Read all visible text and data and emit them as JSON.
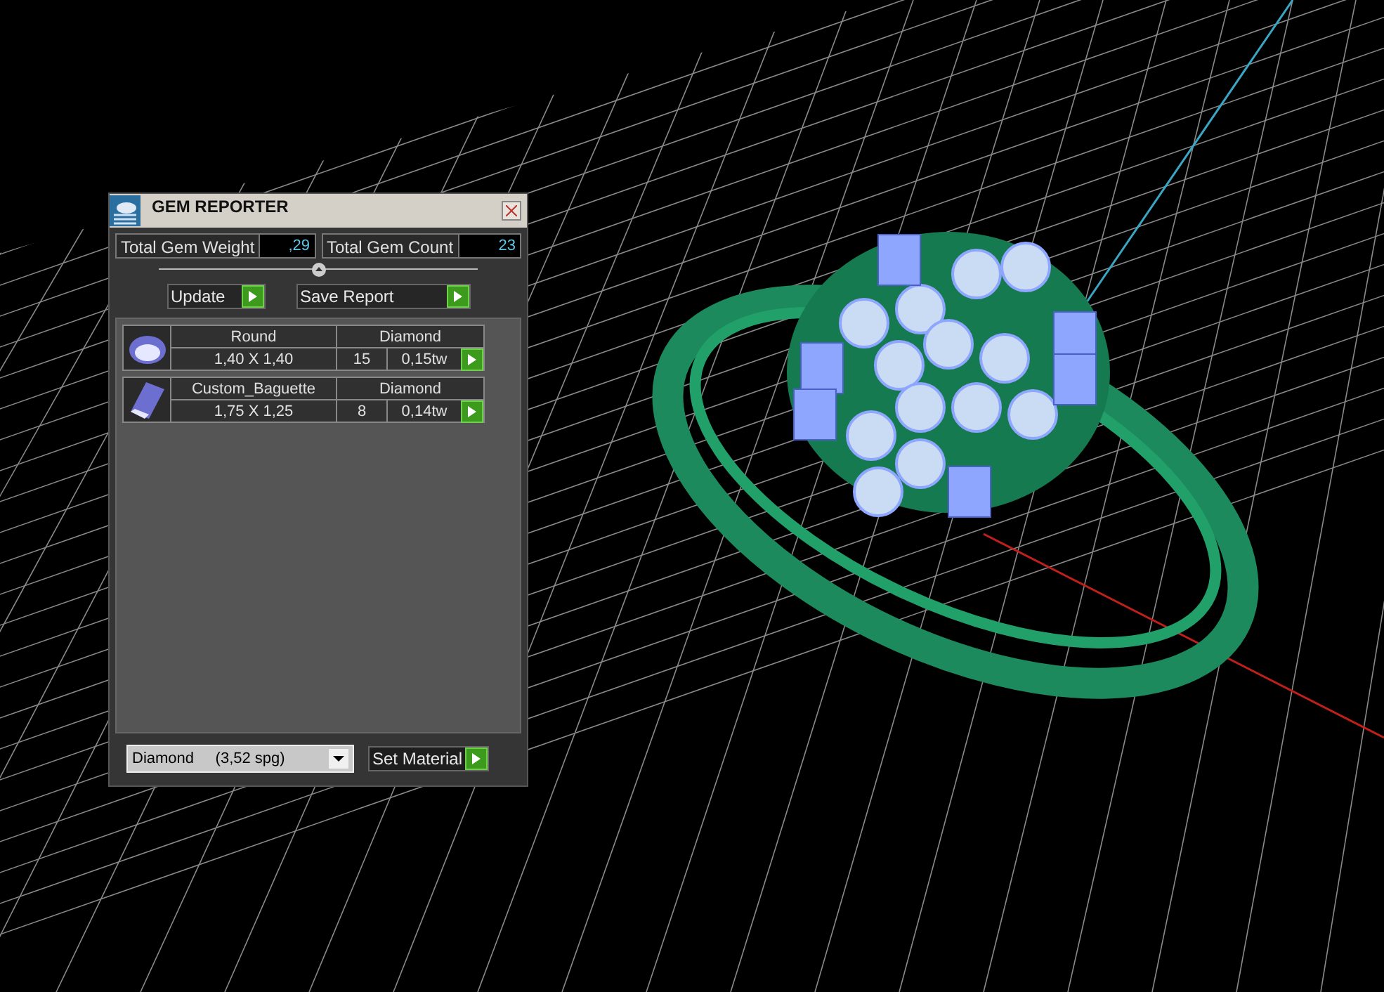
{
  "window": {
    "title": "GEM REPORTER"
  },
  "totals": [
    {
      "label": "Total Gem Weight",
      "value": ",29"
    },
    {
      "label": "Total Gem Count",
      "value": "23"
    }
  ],
  "splitter": {
    "level": 0.5
  },
  "actions": [
    {
      "label": "Update"
    },
    {
      "label": "Save Report"
    }
  ],
  "gems": [
    {
      "kind": "round",
      "name": "Round",
      "material": "Diamond",
      "size": "1,40 X 1,40",
      "count": "15",
      "weight": "0,15tw"
    },
    {
      "kind": "baguette",
      "name": "Custom_Baguette",
      "material": "Diamond",
      "size": "1,75 X 1,25",
      "count": "8",
      "weight": "0,14tw"
    }
  ],
  "material_select": {
    "value": "Diamond     (3,52 spg)"
  },
  "set_material": {
    "label": "Set Material"
  }
}
